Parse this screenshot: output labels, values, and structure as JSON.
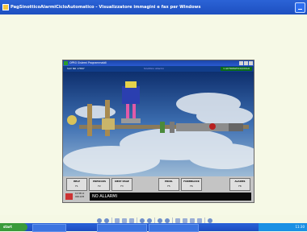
{
  "window": {
    "title": "PagSinotticoAlarmiCicloAutomatico - Visualizzatore immagini e fax per Windows"
  },
  "scada": {
    "title": "OPRO Sistemi Programmabili",
    "status_left": "SAV NR 17867",
    "status_center": "Sinottico Allarmi",
    "status_right": "1 AUTOMATICO/CICLO",
    "buttons": [
      {
        "key": "F1",
        "label": "HELP"
      },
      {
        "key": "F2",
        "label": "PREVIOUS"
      },
      {
        "key": "F3",
        "label": "NEXT PAGE"
      },
      {
        "key": "F5",
        "label": "PROD."
      },
      {
        "key": "F6",
        "label": "FORMBLOCK"
      },
      {
        "key": "F8",
        "label": "ALARMS"
      }
    ],
    "alarm_date": "10:38:14",
    "alarm_time": "04/11/05",
    "alarm_message": "NO ALLARMI"
  },
  "taskbar": {
    "start": "start",
    "tasks": [
      "",
      "",
      ""
    ],
    "clock": "11:30"
  }
}
